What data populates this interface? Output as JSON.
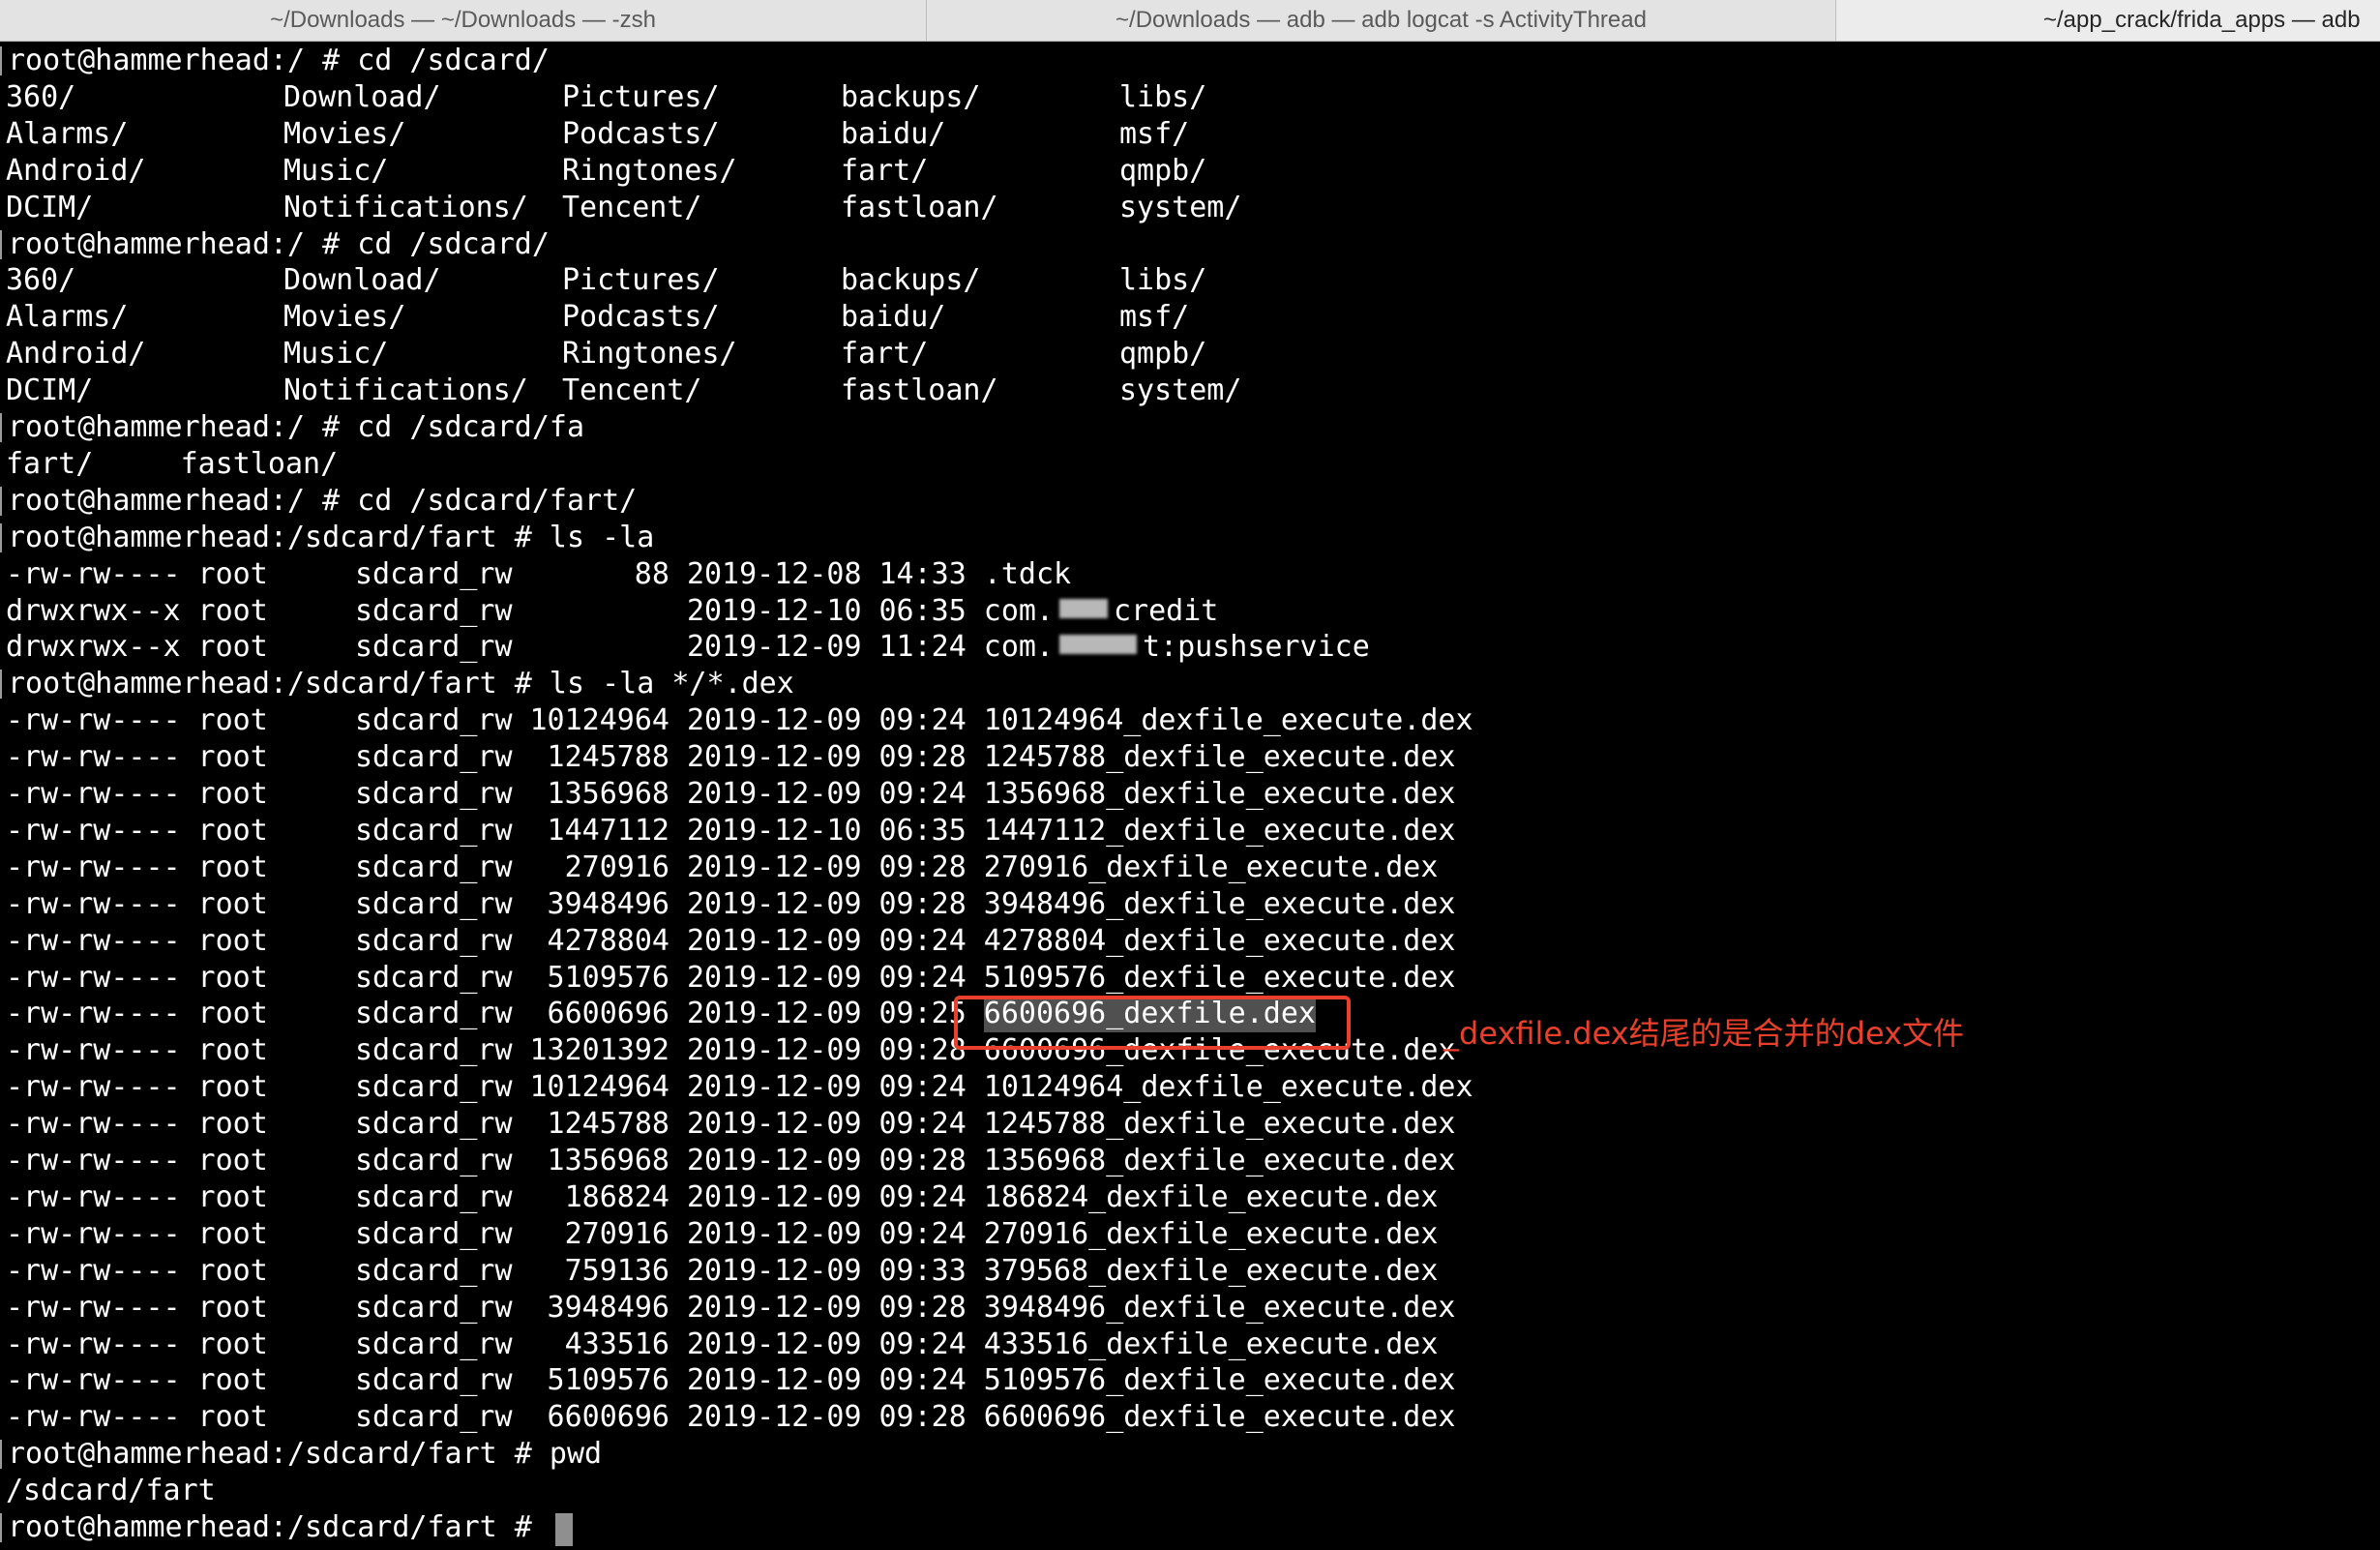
{
  "tabs": [
    {
      "label": "~/Downloads — ~/Downloads — -zsh"
    },
    {
      "label": "~/Downloads — adb — adb logcat -s ActivityThread"
    },
    {
      "label": "~/app_crack/frida_apps — adb"
    }
  ],
  "terminal": {
    "lines": [
      {
        "kind": "prompt",
        "text": "root@hammerhead:/ # cd /sdcard/"
      },
      {
        "kind": "cols",
        "cells": [
          "360/",
          "Download/",
          "Pictures/",
          "backups/",
          "libs/"
        ]
      },
      {
        "kind": "cols",
        "cells": [
          "Alarms/",
          "Movies/",
          "Podcasts/",
          "baidu/",
          "msf/"
        ]
      },
      {
        "kind": "cols",
        "cells": [
          "Android/",
          "Music/",
          "Ringtones/",
          "fart/",
          "qmpb/"
        ]
      },
      {
        "kind": "cols",
        "cells": [
          "DCIM/",
          "Notifications/",
          "Tencent/",
          "fastloan/",
          "system/"
        ]
      },
      {
        "kind": "prompt",
        "text": "root@hammerhead:/ # cd /sdcard/"
      },
      {
        "kind": "cols",
        "cells": [
          "360/",
          "Download/",
          "Pictures/",
          "backups/",
          "libs/"
        ]
      },
      {
        "kind": "cols",
        "cells": [
          "Alarms/",
          "Movies/",
          "Podcasts/",
          "baidu/",
          "msf/"
        ]
      },
      {
        "kind": "cols",
        "cells": [
          "Android/",
          "Music/",
          "Ringtones/",
          "fart/",
          "qmpb/"
        ]
      },
      {
        "kind": "cols",
        "cells": [
          "DCIM/",
          "Notifications/",
          "Tencent/",
          "fastloan/",
          "system/"
        ]
      },
      {
        "kind": "prompt",
        "text": "root@hammerhead:/ # cd /sdcard/fa"
      },
      {
        "kind": "plain",
        "text": "fart/     fastloan/"
      },
      {
        "kind": "prompt",
        "text": "root@hammerhead:/ # cd /sdcard/fart/"
      },
      {
        "kind": "prompt",
        "text": "root@hammerhead:/sdcard/fart # ls -la"
      },
      {
        "kind": "entry",
        "perm": "-rw-rw----",
        "owner": "root",
        "group": "sdcard_rw",
        "size": "88",
        "date": "2019-12-08",
        "time": "14:33",
        "name": ".tdck"
      },
      {
        "kind": "entry",
        "perm": "drwxrwx--x",
        "owner": "root",
        "group": "sdcard_rw",
        "size": "",
        "date": "2019-12-10",
        "time": "06:35",
        "name": "com.",
        "blur": "redact-1",
        "name_tail": "credit"
      },
      {
        "kind": "entry",
        "perm": "drwxrwx--x",
        "owner": "root",
        "group": "sdcard_rw",
        "size": "",
        "date": "2019-12-09",
        "time": "11:24",
        "name": "com.",
        "blur": "redact-2",
        "name_tail": "t:pushservice"
      },
      {
        "kind": "prompt",
        "text": "root@hammerhead:/sdcard/fart # ls -la */*.dex"
      },
      {
        "kind": "entry",
        "perm": "-rw-rw----",
        "owner": "root",
        "group": "sdcard_rw",
        "size": "10124964",
        "date": "2019-12-09",
        "time": "09:24",
        "name": "10124964_dexfile_execute.dex"
      },
      {
        "kind": "entry",
        "perm": "-rw-rw----",
        "owner": "root",
        "group": "sdcard_rw",
        "size": "1245788",
        "date": "2019-12-09",
        "time": "09:28",
        "name": "1245788_dexfile_execute.dex"
      },
      {
        "kind": "entry",
        "perm": "-rw-rw----",
        "owner": "root",
        "group": "sdcard_rw",
        "size": "1356968",
        "date": "2019-12-09",
        "time": "09:24",
        "name": "1356968_dexfile_execute.dex"
      },
      {
        "kind": "entry",
        "perm": "-rw-rw----",
        "owner": "root",
        "group": "sdcard_rw",
        "size": "1447112",
        "date": "2019-12-10",
        "time": "06:35",
        "name": "1447112_dexfile_execute.dex"
      },
      {
        "kind": "entry",
        "perm": "-rw-rw----",
        "owner": "root",
        "group": "sdcard_rw",
        "size": "270916",
        "date": "2019-12-09",
        "time": "09:28",
        "name": "270916_dexfile_execute.dex"
      },
      {
        "kind": "entry",
        "perm": "-rw-rw----",
        "owner": "root",
        "group": "sdcard_rw",
        "size": "3948496",
        "date": "2019-12-09",
        "time": "09:28",
        "name": "3948496_dexfile_execute.dex"
      },
      {
        "kind": "entry",
        "perm": "-rw-rw----",
        "owner": "root",
        "group": "sdcard_rw",
        "size": "4278804",
        "date": "2019-12-09",
        "time": "09:24",
        "name": "4278804_dexfile_execute.dex"
      },
      {
        "kind": "entry",
        "perm": "-rw-rw----",
        "owner": "root",
        "group": "sdcard_rw",
        "size": "5109576",
        "date": "2019-12-09",
        "time": "09:24",
        "name": "5109576_dexfile_execute.dex"
      },
      {
        "kind": "entry",
        "perm": "-rw-rw----",
        "owner": "root",
        "group": "sdcard_rw",
        "size": "6600696",
        "date": "2019-12-09",
        "time": "09:25",
        "name": "6600696_dexfile.dex",
        "selected": true
      },
      {
        "kind": "entry",
        "perm": "-rw-rw----",
        "owner": "root",
        "group": "sdcard_rw",
        "size": "13201392",
        "date": "2019-12-09",
        "time": "09:28",
        "name": "6600696_dexfile_execute.dex"
      },
      {
        "kind": "entry",
        "perm": "-rw-rw----",
        "owner": "root",
        "group": "sdcard_rw",
        "size": "10124964",
        "date": "2019-12-09",
        "time": "09:24",
        "name": "10124964_dexfile_execute.dex"
      },
      {
        "kind": "entry",
        "perm": "-rw-rw----",
        "owner": "root",
        "group": "sdcard_rw",
        "size": "1245788",
        "date": "2019-12-09",
        "time": "09:24",
        "name": "1245788_dexfile_execute.dex"
      },
      {
        "kind": "entry",
        "perm": "-rw-rw----",
        "owner": "root",
        "group": "sdcard_rw",
        "size": "1356968",
        "date": "2019-12-09",
        "time": "09:28",
        "name": "1356968_dexfile_execute.dex"
      },
      {
        "kind": "entry",
        "perm": "-rw-rw----",
        "owner": "root",
        "group": "sdcard_rw",
        "size": "186824",
        "date": "2019-12-09",
        "time": "09:24",
        "name": "186824_dexfile_execute.dex"
      },
      {
        "kind": "entry",
        "perm": "-rw-rw----",
        "owner": "root",
        "group": "sdcard_rw",
        "size": "270916",
        "date": "2019-12-09",
        "time": "09:24",
        "name": "270916_dexfile_execute.dex"
      },
      {
        "kind": "entry",
        "perm": "-rw-rw----",
        "owner": "root",
        "group": "sdcard_rw",
        "size": "759136",
        "date": "2019-12-09",
        "time": "09:33",
        "name": "379568_dexfile_execute.dex"
      },
      {
        "kind": "entry",
        "perm": "-rw-rw----",
        "owner": "root",
        "group": "sdcard_rw",
        "size": "3948496",
        "date": "2019-12-09",
        "time": "09:28",
        "name": "3948496_dexfile_execute.dex"
      },
      {
        "kind": "entry",
        "perm": "-rw-rw----",
        "owner": "root",
        "group": "sdcard_rw",
        "size": "433516",
        "date": "2019-12-09",
        "time": "09:24",
        "name": "433516_dexfile_execute.dex"
      },
      {
        "kind": "entry",
        "perm": "-rw-rw----",
        "owner": "root",
        "group": "sdcard_rw",
        "size": "5109576",
        "date": "2019-12-09",
        "time": "09:24",
        "name": "5109576_dexfile_execute.dex"
      },
      {
        "kind": "entry",
        "perm": "-rw-rw----",
        "owner": "root",
        "group": "sdcard_rw",
        "size": "6600696",
        "date": "2019-12-09",
        "time": "09:28",
        "name": "6600696_dexfile_execute.dex"
      },
      {
        "kind": "prompt",
        "text": "root@hammerhead:/sdcard/fart # pwd"
      },
      {
        "kind": "plain",
        "text": "/sdcard/fart"
      },
      {
        "kind": "prompt",
        "text": "root@hammerhead:/sdcard/fart # ",
        "cursor": true
      }
    ]
  },
  "annotation": {
    "text": "_dexfile.dex结尾的是合并的dex文件",
    "color": "#e8402c"
  },
  "colors": {
    "background": "#000000",
    "text": "#ffffff",
    "accent": "#e8402c"
  }
}
